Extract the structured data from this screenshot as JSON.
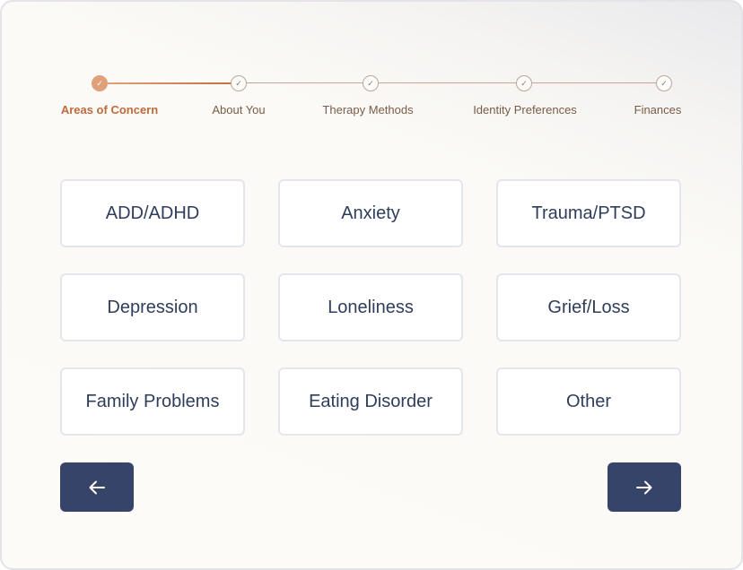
{
  "stepper": {
    "steps": [
      {
        "label": "Areas of Concern",
        "state": "active"
      },
      {
        "label": "About You",
        "state": "pending"
      },
      {
        "label": "Therapy Methods",
        "state": "pending"
      },
      {
        "label": "Identity Preferences",
        "state": "pending"
      },
      {
        "label": "Finances",
        "state": "pending"
      }
    ],
    "check_glyph": "✓"
  },
  "options": [
    "ADD/ADHD",
    "Anxiety",
    "Trauma/PTSD",
    "Depression",
    "Loneliness",
    "Grief/Loss",
    "Family Problems",
    "Eating Disorder",
    "Other"
  ],
  "nav": {
    "back_icon": "arrow-left-icon",
    "next_icon": "arrow-right-icon"
  },
  "colors": {
    "accent": "#e0a07a",
    "accent_text": "#bf6a3d",
    "button_bg": "#37446a",
    "option_text": "#2f3d5c"
  }
}
